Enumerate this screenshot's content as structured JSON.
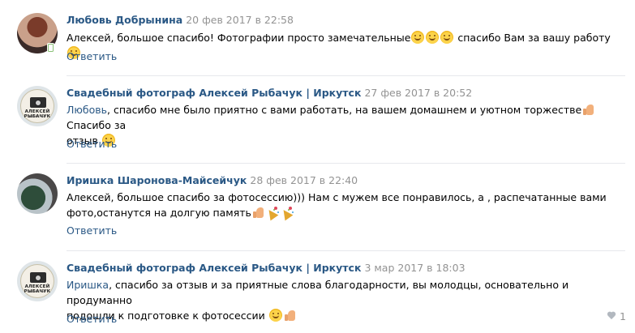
{
  "comments": [
    {
      "author": "Любовь Добрынина",
      "date": "20 фев 2017 в 22:58",
      "text_parts": [
        "Алексей, большое спасибо! Фотографии просто замечательные",
        " спасибо Вам за вашу работу"
      ],
      "emojis": [
        "smile-emoji",
        "smile-emoji",
        "smile-emoji",
        "smile-emoji"
      ],
      "reply": "Ответить",
      "avatar": "user-photo",
      "online": true
    },
    {
      "author": "Свадебный фотограф Алексей Рыбачук | Иркутск",
      "date": "27 фев 2017 в 20:52",
      "mention": "Любовь",
      "text_parts": [
        ", спасибо мне было приятно с вами работать, на вашем домашнем и уютном торжестве",
        " Спасибо за",
        "отзыв"
      ],
      "emojis": [
        "thumbs-up-emoji",
        "smile-emoji"
      ],
      "reply": "Ответить",
      "avatar": "photographer-logo"
    },
    {
      "author": "Иришка Шаронова-Майсейчук",
      "date": "28 фев 2017 в 22:40",
      "text_parts": [
        "Алексей, большое спасибо за фотосессию))) Нам с мужем все понравилось, а , распечатанные вами",
        "фото,останутся на долгую память"
      ],
      "emojis": [
        "thumbs-up-emoji",
        "party-popper-emoji",
        "party-popper-emoji"
      ],
      "reply": "Ответить",
      "avatar": "user-photo"
    },
    {
      "author": "Свадебный фотограф Алексей Рыбачук | Иркутск",
      "date": "3 мар 2017 в 18:03",
      "mention": "Иришка",
      "text_parts": [
        ", спасибо за отзыв и за приятные слова благодарности, вы молодцы, основательно и продуманно",
        "подошли к подготовке к фотосессии"
      ],
      "emojis": [
        "smile-emoji",
        "thumbs-up-emoji"
      ],
      "reply": "Ответить",
      "avatar": "photographer-logo"
    }
  ],
  "logo": {
    "name": "АЛЕКСЕЙ РЫБАЧУК",
    "subtitle": "ФОТОГРАФ"
  },
  "like": {
    "icon": "heart-icon",
    "count": "1"
  },
  "colors": {
    "link": "#2a5885",
    "meta": "#939393",
    "divider": "#e7e8ec",
    "online": "#8ac176"
  }
}
